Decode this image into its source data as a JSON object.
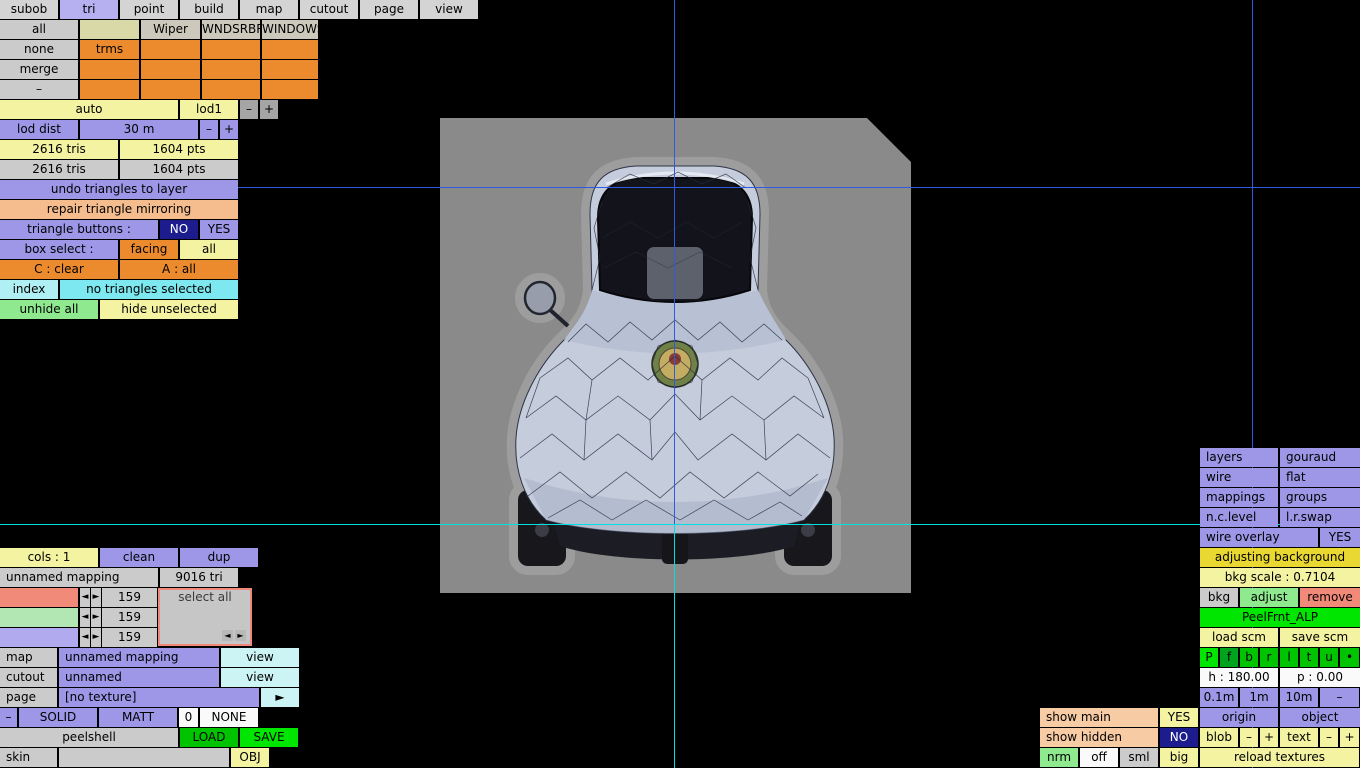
{
  "colors": {
    "accent_lavender": "#9e97e8",
    "accent_orange": "#ec8a2e",
    "accent_yellow": "#f3f3a2",
    "accent_green": "#00e600",
    "accent_cyan": "#7de8f0",
    "guide_blue": "#2e5cdf",
    "guide_cyan": "#00e0e0"
  },
  "menu": {
    "tabs": [
      "subob",
      "tri",
      "point",
      "build",
      "map",
      "cutout",
      "page",
      "view"
    ],
    "active": "tri"
  },
  "subob_grid": {
    "all": "all",
    "none": "none",
    "merge": "merge",
    "minus": "–",
    "trms": "trms",
    "groups": [
      "Wiper",
      "WNDSRBR",
      "WINDOWS"
    ]
  },
  "lod": {
    "auto": "auto",
    "lod1": "lod1",
    "minus": "–",
    "plus": "+",
    "dist_label": "lod dist",
    "dist_value": "30 m"
  },
  "stats": {
    "selected_tris": "2616 tris",
    "selected_pts": "1604 pts",
    "total_tris": "2616 tris",
    "total_pts": "1604 pts"
  },
  "tri_tools": {
    "undo": "undo triangles to layer",
    "repair": "repair triangle mirroring",
    "triangle_buttons_label": "triangle buttons :",
    "no": "NO",
    "yes": "YES",
    "box_select_label": "box select :",
    "facing": "facing",
    "all": "all",
    "c_clear": "C : clear",
    "a_all": "A : all",
    "index": "index",
    "status": "no triangles selected",
    "unhide_all": "unhide all",
    "hide_unselected": "hide unselected"
  },
  "mapping": {
    "cols": "cols : 1",
    "clean": "clean",
    "dup": "dup",
    "name": "unnamed mapping",
    "tris": "9016 tri",
    "channel_values": [
      "159",
      "159",
      "159"
    ],
    "arrow_left": "◄",
    "arrow_right": "►",
    "select_all": "select all",
    "map_label": "map",
    "map_value": "unnamed mapping",
    "map_action": "view",
    "cutout_label": "cutout",
    "cutout_value": "unnamed",
    "cutout_action": "view",
    "page_label": "page",
    "page_value": "[no texture]",
    "page_action": "►",
    "minus": "–",
    "solid": "SOLID",
    "matt": "MATT",
    "zero": "0",
    "none": "NONE",
    "file_name": "peelshell",
    "load": "LOAD",
    "save": "SAVE",
    "skin": "skin",
    "obj": "OBJ"
  },
  "view_opts": {
    "layers": "layers",
    "gouraud": "gouraud",
    "wire": "wire",
    "flat": "flat",
    "mappings": "mappings",
    "groups": "groups",
    "nc_level": "n.c.level",
    "lr_swap": "l.r.swap",
    "wire_overlay": "wire overlay",
    "wire_overlay_value": "YES",
    "adjusting_background": "adjusting background",
    "bkg_scale": "bkg scale : 0.7104",
    "bkg": "bkg",
    "adjust": "adjust",
    "remove": "remove",
    "texture_name": "PeelFrnt_ALP",
    "load_scm": "load scm",
    "save_scm": "save scm",
    "keys": [
      "P",
      "f",
      "b",
      "r",
      "l",
      "t",
      "u",
      "•"
    ],
    "heading": "h : 180.00",
    "pitch": "p : 0.00",
    "steps": [
      "0.1m",
      "1m",
      "10m",
      "–"
    ]
  },
  "display": {
    "show_main": "show main",
    "show_main_value": "YES",
    "origin": "origin",
    "object": "object",
    "show_hidden": "show hidden",
    "show_hidden_value": "NO",
    "blob": "blob",
    "text": "text",
    "minus": "–",
    "plus": "+",
    "nrm": "nrm",
    "off": "off",
    "sml": "sml",
    "big": "big",
    "reload": "reload textures"
  }
}
